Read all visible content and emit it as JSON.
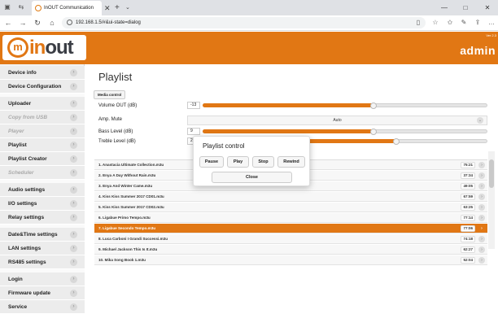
{
  "browser": {
    "tab_title": "InOUT Communication",
    "url": "192.168.1.5/#&ui-state=dialog",
    "window_buttons": [
      "—",
      "□",
      "✕"
    ]
  },
  "header": {
    "logo_text_in": "in",
    "logo_text_out": "out",
    "logo_mark": "m",
    "version": "Ver 2.3",
    "user": "admin",
    "brand_color": "#e17714"
  },
  "sidebar": {
    "items": [
      {
        "label": "Device info",
        "disabled": false
      },
      {
        "label": "Device Configuration",
        "disabled": false
      },
      {
        "label": "Uploader",
        "disabled": false
      },
      {
        "label": "Copy from USB",
        "disabled": true
      },
      {
        "label": "Player",
        "disabled": true
      },
      {
        "label": "Playlist",
        "disabled": false
      },
      {
        "label": "Playlist Creator",
        "disabled": false
      },
      {
        "label": "Scheduler",
        "disabled": true
      },
      {
        "label": "Audio settings",
        "disabled": false
      },
      {
        "label": "I/O settings",
        "disabled": false
      },
      {
        "label": "Relay settings",
        "disabled": false
      },
      {
        "label": "Date&Time settings",
        "disabled": false
      },
      {
        "label": "LAN settings",
        "disabled": false
      },
      {
        "label": "RS485 settings",
        "disabled": false
      },
      {
        "label": "Login",
        "disabled": false
      },
      {
        "label": "Firmware update",
        "disabled": false
      },
      {
        "label": "Service",
        "disabled": false
      }
    ]
  },
  "main": {
    "title": "Playlist",
    "media_control_label": "Media control",
    "volume": {
      "label": "Volume OUT (dB)",
      "value": "-13",
      "level": 0.6
    },
    "mute": {
      "label": "Amp. Mute",
      "value": "Auto"
    },
    "bass": {
      "label": "Bass Level (dB)",
      "value": "9",
      "level": 0.6
    },
    "treble": {
      "label": "Treble Level (dB)",
      "value": "2",
      "level": 0.68
    }
  },
  "playlist": [
    {
      "name": "1. Anastacia Ultimate Collection.m3u",
      "time": "75:21",
      "selected": false
    },
    {
      "name": "2. Enya A Day Without Rain.m3u",
      "time": "37:34",
      "selected": false
    },
    {
      "name": "3. Enya And Winter Came.m3u",
      "time": "49:05",
      "selected": false
    },
    {
      "name": "4. Kiss Kiss Summer 2017 CD01.m3u",
      "time": "67:59",
      "selected": false
    },
    {
      "name": "5. Kiss Kiss Summer 2017 CD02.m3u",
      "time": "63:25",
      "selected": false
    },
    {
      "name": "6. Ligabue Primo Tempo.m3u",
      "time": "77:14",
      "selected": false
    },
    {
      "name": "7. Ligabue Secondo Tempo.m3u",
      "time": "77:06",
      "selected": true
    },
    {
      "name": "8. Luca Carboni I Grandi Successi.m3u",
      "time": "74:18",
      "selected": false
    },
    {
      "name": "9. Michael Jackson This Is It.m3u",
      "time": "62:27",
      "selected": false
    },
    {
      "name": "10. Mika Song Book 1.m3u",
      "time": "52:04",
      "selected": false
    }
  ],
  "dialog": {
    "title": "Playlist control",
    "buttons": [
      "Pause",
      "Play",
      "Stop",
      "Rewind"
    ],
    "close_label": "Close"
  }
}
